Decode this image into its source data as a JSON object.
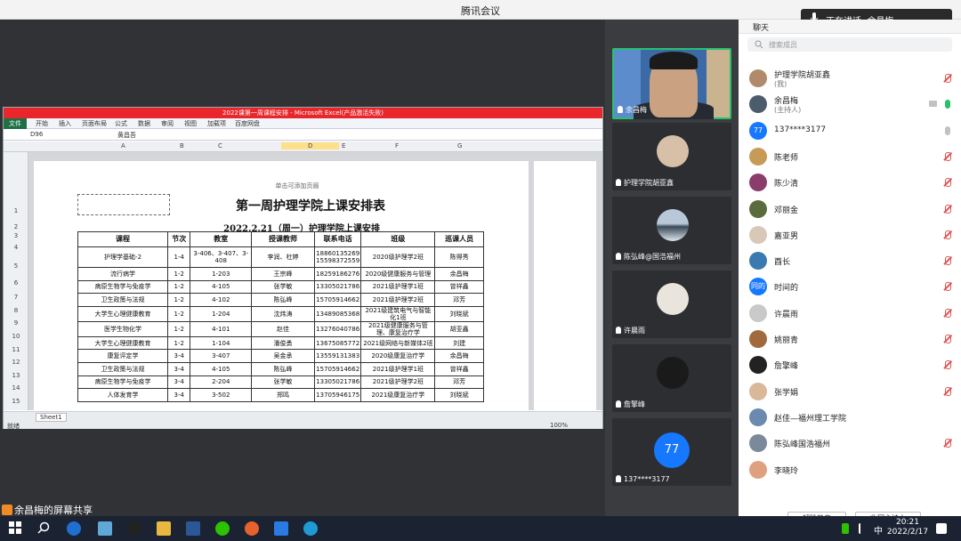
{
  "window": {
    "title": "腾讯会议"
  },
  "speaking": {
    "label": "正在讲话: 余昌梅"
  },
  "excel": {
    "title": "2022课第一周课程安排 - Microsoft Excel(产品激活失败)",
    "ribbon_file": "文件",
    "ribbon_tabs": [
      "开始",
      "插入",
      "页面布局",
      "公式",
      "数据",
      "审阅",
      "视图",
      "加载项",
      "百度网盘"
    ],
    "name_box": "D96",
    "formula_value": "黄昌吾",
    "columns": [
      "A",
      "B",
      "C",
      "D",
      "E",
      "F",
      "G"
    ],
    "rows": [
      "1",
      "2",
      "3",
      "4",
      "5",
      "6",
      "7",
      "8",
      "9",
      "10",
      "11",
      "12",
      "13",
      "14",
      "15"
    ],
    "header_hint": "单击可添加页眉",
    "sheet_tab": "Sheet1",
    "status_ready": "就绪",
    "zoom": "100%"
  },
  "schedule": {
    "title": "第一周护理学院上课安排表",
    "subtitle": "2022.2.21（周一）护理学院上课安排",
    "headers": [
      "课程",
      "节次",
      "教室",
      "授课教师",
      "联系电话",
      "班级",
      "巡课人员"
    ],
    "rows": [
      [
        "护理学基础-2",
        "1-4",
        "3-406、3-407、3-408",
        "李润、杜婷",
        "18860135269\n15598372559",
        "2020级护理学2班",
        "陈得秀"
      ],
      [
        "流行病学",
        "1-2",
        "1-203",
        "王宗峰",
        "18259186276",
        "2020级健康服务与管理",
        "余昌梅"
      ],
      [
        "病原生物学与免疫学",
        "1-2",
        "4-105",
        "张学敏",
        "13305021786",
        "2021级护理学1班",
        "曾祥鑫"
      ],
      [
        "卫生政策与法规",
        "1-2",
        "4-102",
        "陈弘峰",
        "15705914662",
        "2021级护理学2班",
        "邓芳"
      ],
      [
        "大学生心理健康教育",
        "1-2",
        "1-204",
        "沈炜涛",
        "13489085368",
        "2021级建筑电气与智能化1班",
        "刘晓斌"
      ],
      [
        "医学生物化学",
        "1-2",
        "4-101",
        "赵佳",
        "13276040786",
        "2021级健康服务与管理、康复治疗学",
        "胡亚鑫"
      ],
      [
        "大学生心理健康教育",
        "1-2",
        "1-104",
        "潘俊勇",
        "13675085772",
        "2021级网络与新媒体2班",
        "刘建"
      ],
      [
        "康复评定学",
        "3-4",
        "3-407",
        "吴金承",
        "13559131383",
        "2020级康复治疗学",
        "余昌梅"
      ],
      [
        "卫生政策与法规",
        "3-4",
        "4-105",
        "陈弘峰",
        "15705914662",
        "2021级护理学1班",
        "曾祥鑫"
      ],
      [
        "病原生物学与免疫学",
        "3-4",
        "2-204",
        "张学敏",
        "13305021786",
        "2021级护理学2班",
        "邓芳"
      ],
      [
        "人体发育学",
        "3-4",
        "3-502",
        "郑鸣",
        "13705946175",
        "2021级康复治疗学",
        "刘晓斌"
      ]
    ]
  },
  "videos": [
    {
      "name": "余昌梅",
      "type": "camera"
    },
    {
      "name": "护理学院胡亚鑫",
      "type": "avatar"
    },
    {
      "name": "陈弘峰@国浩福州",
      "type": "avatar"
    },
    {
      "name": "许晨雨",
      "type": "avatar"
    },
    {
      "name": "詹擎峰",
      "type": "avatar"
    },
    {
      "name": "137****3177",
      "type": "number",
      "badge": "77"
    }
  ],
  "side": {
    "header": "聊天",
    "search_placeholder": "搜索成员",
    "members": [
      {
        "name": "护理学院胡亚鑫",
        "sub": "(我)",
        "avatar": "",
        "color": "#b08a6a"
      },
      {
        "name": "余昌梅",
        "sub": "(主持人)",
        "avatar": "",
        "color": "#4d5c6b"
      },
      {
        "name": "137****3177",
        "sub": "",
        "avatar": "77",
        "color": "#1677ff"
      },
      {
        "name": "陈老师",
        "sub": "",
        "avatar": "",
        "color": "#c79a57"
      },
      {
        "name": "陈少清",
        "sub": "",
        "avatar": "",
        "color": "#8a3d6b"
      },
      {
        "name": "邓丽金",
        "sub": "",
        "avatar": "",
        "color": "#5a6b3d"
      },
      {
        "name": "嘉亚男",
        "sub": "",
        "avatar": "",
        "color": "#d8c8b8"
      },
      {
        "name": "酉长",
        "sub": "",
        "avatar": "",
        "color": "#3a7ab0"
      },
      {
        "name": "时间的",
        "sub": "",
        "avatar": "同的",
        "color": "#1677ff"
      },
      {
        "name": "许晨雨",
        "sub": "",
        "avatar": "",
        "color": "#c9c9c9"
      },
      {
        "name": "姚丽青",
        "sub": "",
        "avatar": "",
        "color": "#a06a3d"
      },
      {
        "name": "詹擎峰",
        "sub": "",
        "avatar": "",
        "color": "#222222"
      },
      {
        "name": "张学娟",
        "sub": "",
        "avatar": "",
        "color": "#d9b899"
      },
      {
        "name": "赵佳—福州理工学院",
        "sub": "",
        "avatar": "",
        "color": "#6a8ab0"
      },
      {
        "name": "陈弘峰国浩福州",
        "sub": "",
        "avatar": "",
        "color": "#7a8a9a"
      },
      {
        "name": "李晓玲",
        "sub": "",
        "avatar": "",
        "color": "#e0a080"
      }
    ],
    "btn_unmute": "解除静音",
    "btn_reclaim": "收回主持人"
  },
  "share_label": "余昌梅的屏幕共享",
  "taskbar": {
    "time": "20:21",
    "date": "2022/2/17",
    "ime": "中"
  }
}
